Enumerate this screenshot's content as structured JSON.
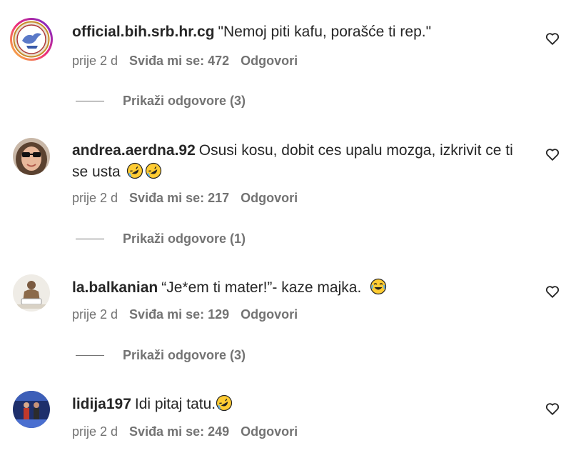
{
  "comments": [
    {
      "username": "official.bih.srb.hr.cg",
      "text": "\"Nemoj piti kafu, porašće ti rep.\"",
      "time": "prije 2 d",
      "likes": "Sviđa mi se: 472",
      "reply": "Odgovori",
      "view_replies": "Prikaži odgovore (3)"
    },
    {
      "username": "andrea.aerdna.92",
      "text": "Osusi kosu, dobit ces upalu mozga, izkrivit ce ti se usta",
      "time": "prije 2 d",
      "likes": "Sviđa mi se: 217",
      "reply": "Odgovori",
      "view_replies": "Prikaži odgovore (1)"
    },
    {
      "username": "la.balkanian",
      "text": "“Je*em ti mater!”- kaze majka.",
      "time": "prije 2 d",
      "likes": "Sviđa mi se: 129",
      "reply": "Odgovori",
      "view_replies": "Prikaži odgovore (3)"
    },
    {
      "username": "lidija197",
      "text": "Idi pitaj tatu.",
      "time": "prije 2 d",
      "likes": "Sviđa mi se: 249",
      "reply": "Odgovori"
    }
  ],
  "icons": {
    "heart": "heart-outline-icon",
    "emoji_rofl": "rolling-on-floor-laughing-emoji",
    "emoji_tears": "face-with-tears-of-joy-emoji"
  },
  "colors": {
    "text": "#262626",
    "secondary": "#737373",
    "background": "#ffffff"
  }
}
